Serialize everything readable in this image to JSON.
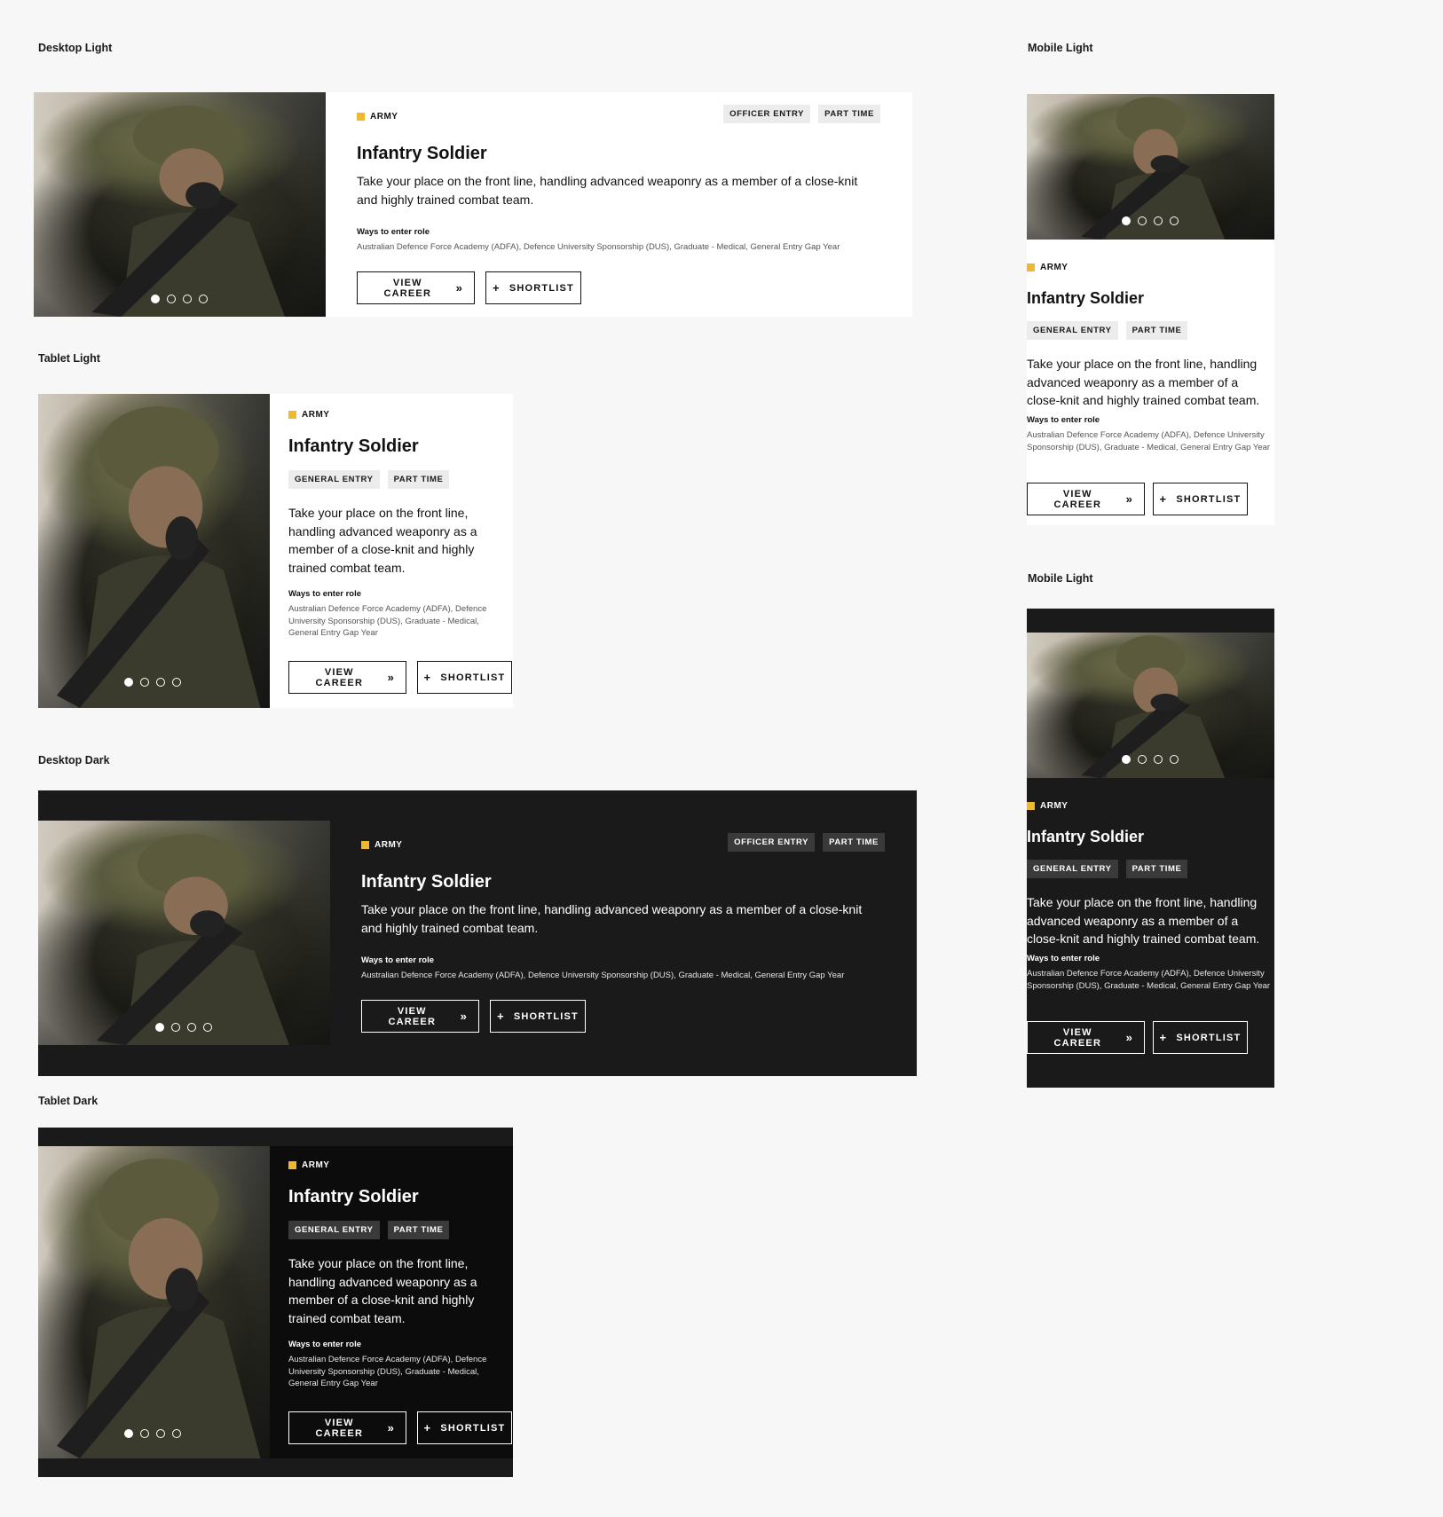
{
  "labels": {
    "desktop_light": "Desktop Light",
    "tablet_light": "Tablet Light",
    "desktop_dark": "Desktop Dark",
    "tablet_dark": "Tablet Dark",
    "mobile_light_1": "Mobile Light",
    "mobile_light_2": "Mobile Light"
  },
  "card": {
    "branch": "ARMY",
    "title": "Infantry Soldier",
    "desktop_tags": [
      "OFFICER ENTRY",
      "PART TIME"
    ],
    "tags": [
      "GENERAL ENTRY",
      "PART TIME"
    ],
    "description": "Take your place on the front line, handling advanced weaponry as a member of a close-knit and highly trained combat team.",
    "ways_label": "Ways to enter role",
    "ways_value": "Australian Defence Force Academy (ADFA), Defence University Sponsorship (DUS), Graduate - Medical, General Entry Gap Year",
    "view_career": "VIEW CAREER",
    "shortlist": "SHORTLIST",
    "carousel_total": 4,
    "carousel_active": 1
  },
  "colors": {
    "accent": "#f2b72c",
    "dark_bg": "#1a1a1a",
    "page_bg": "#f7f7f7"
  },
  "icons": {
    "branch_marker": "square-icon",
    "view_career": "double-chevron-right-icon",
    "shortlist": "plus-icon"
  }
}
